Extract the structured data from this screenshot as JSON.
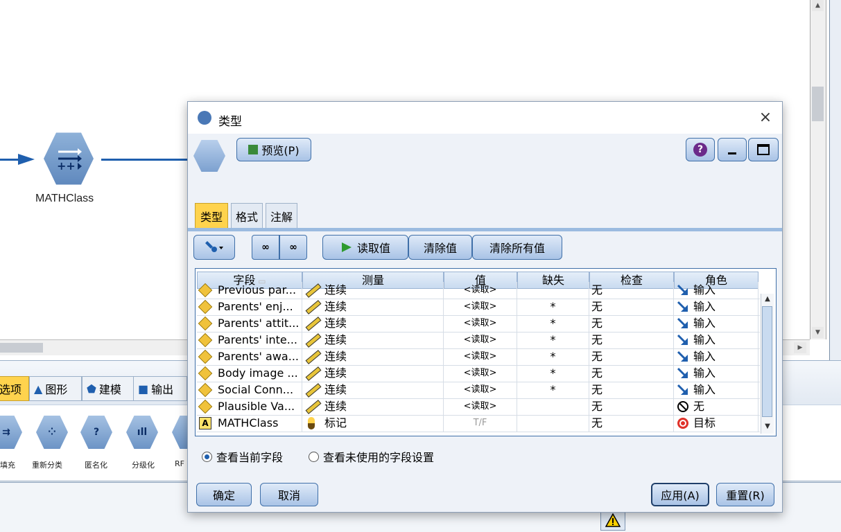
{
  "canvas": {
    "node_label": "MATHClass"
  },
  "palette": {
    "tabs": [
      {
        "label": "选项",
        "icon": "none",
        "active": true
      },
      {
        "label": "图形",
        "icon": "triangle-icon"
      },
      {
        "label": "建模",
        "icon": "pentagon-icon"
      },
      {
        "label": "输出",
        "icon": "square-icon"
      }
    ],
    "nodes": [
      {
        "label": "填充"
      },
      {
        "label": "重新分类"
      },
      {
        "label": "匿名化"
      },
      {
        "label": "分级化"
      },
      {
        "label": "RF"
      }
    ]
  },
  "dialog": {
    "title": "类型",
    "close_label": "×",
    "preview_label": "预览(P)",
    "help_label": "?",
    "tabs": [
      {
        "label": "类型",
        "active": true
      },
      {
        "label": "格式",
        "active": false
      },
      {
        "label": "注解",
        "active": false
      }
    ],
    "toolbar": {
      "read_values": "读取值",
      "clear_values": "清除值",
      "clear_all_values": "清除所有值"
    },
    "table": {
      "columns": [
        "字段",
        "测量",
        "值",
        "缺失",
        "检查",
        "角色"
      ],
      "rows": [
        {
          "field": "Previous par...",
          "measure": "连续",
          "value": "<读取>",
          "missing": "",
          "check": "无",
          "role": "输入",
          "field_type": "continuous",
          "role_type": "input"
        },
        {
          "field": "Parents' enj...",
          "measure": "连续",
          "value": "<读取>",
          "missing": "*",
          "check": "无",
          "role": "输入",
          "field_type": "continuous",
          "role_type": "input"
        },
        {
          "field": "Parents' attit...",
          "measure": "连续",
          "value": "<读取>",
          "missing": "*",
          "check": "无",
          "role": "输入",
          "field_type": "continuous",
          "role_type": "input"
        },
        {
          "field": "Parents' inte...",
          "measure": "连续",
          "value": "<读取>",
          "missing": "*",
          "check": "无",
          "role": "输入",
          "field_type": "continuous",
          "role_type": "input"
        },
        {
          "field": "Parents' awa...",
          "measure": "连续",
          "value": "<读取>",
          "missing": "*",
          "check": "无",
          "role": "输入",
          "field_type": "continuous",
          "role_type": "input"
        },
        {
          "field": "Body image ...",
          "measure": "连续",
          "value": "<读取>",
          "missing": "*",
          "check": "无",
          "role": "输入",
          "field_type": "continuous",
          "role_type": "input"
        },
        {
          "field": "Social Conn...",
          "measure": "连续",
          "value": "<读取>",
          "missing": "*",
          "check": "无",
          "role": "输入",
          "field_type": "continuous",
          "role_type": "input"
        },
        {
          "field": "Plausible Va...",
          "measure": "连续",
          "value": "<读取>",
          "missing": "",
          "check": "无",
          "role": "无",
          "field_type": "continuous",
          "role_type": "none"
        },
        {
          "field": "MATHClass",
          "measure": "标记",
          "value": "T/F",
          "missing": "",
          "check": "无",
          "role": "目标",
          "field_type": "flag",
          "role_type": "target"
        }
      ]
    },
    "radios": [
      {
        "label": "查看当前字段",
        "selected": true
      },
      {
        "label": "查看未使用的字段设置",
        "selected": false
      }
    ],
    "buttons": {
      "ok": "确定",
      "cancel": "取消",
      "apply": "应用(A)",
      "reset": "重置(R)"
    }
  }
}
